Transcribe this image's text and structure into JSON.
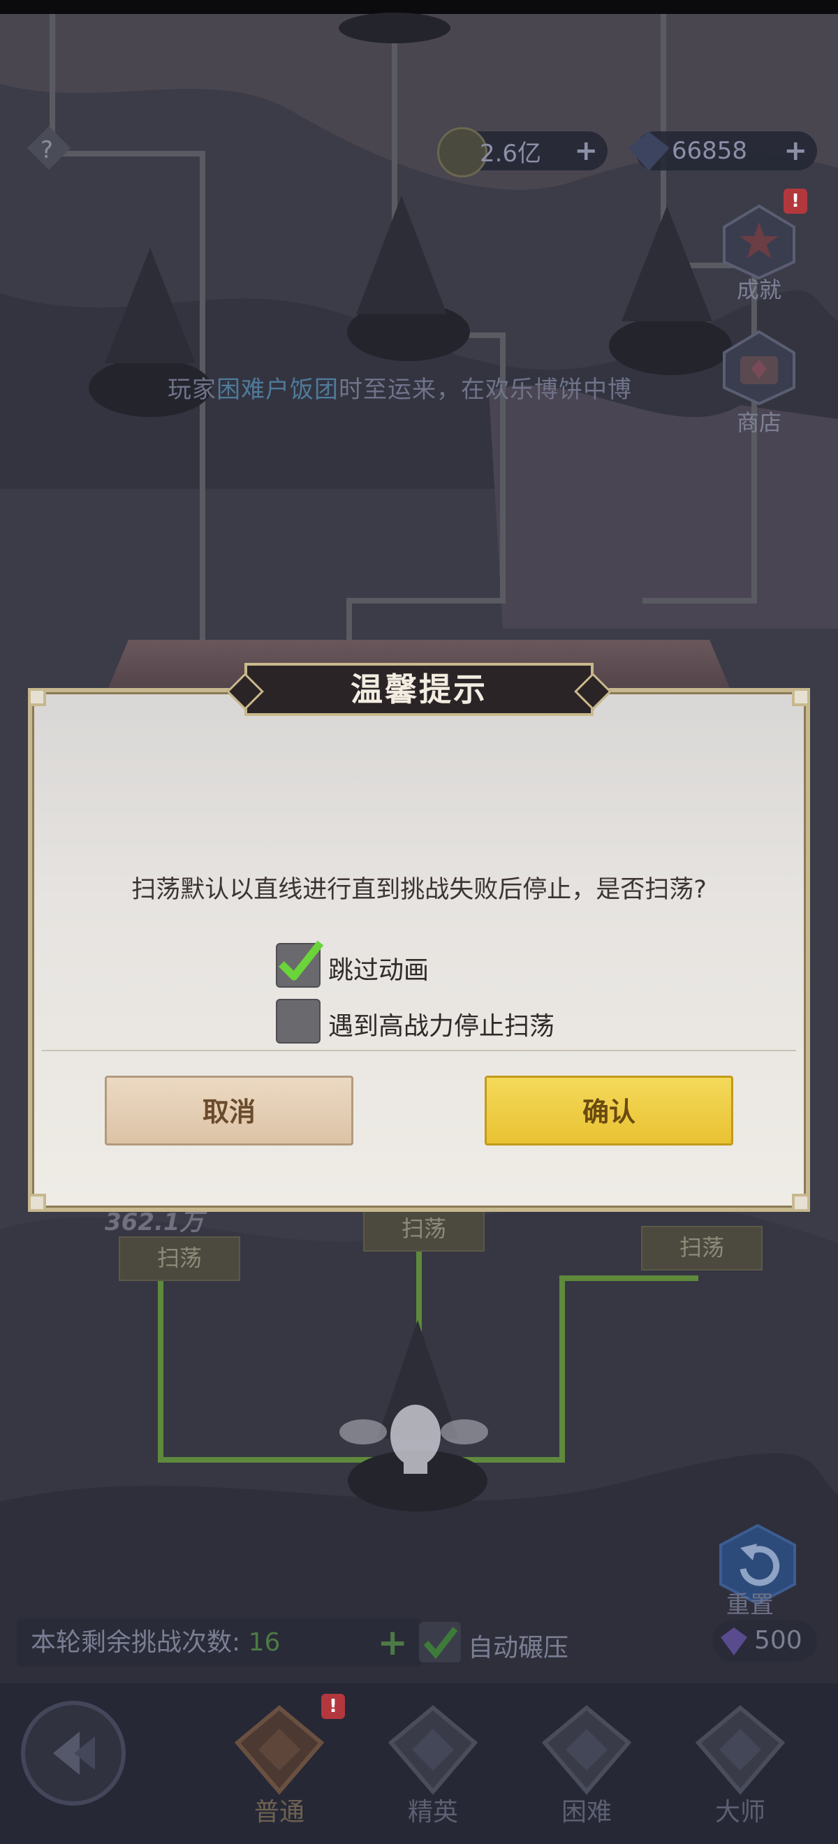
{
  "currency": {
    "gold": "2.6亿",
    "gems": "66858",
    "plus": "+"
  },
  "side": {
    "achievement": "成就",
    "shop": "商店",
    "alert": "!"
  },
  "ticker": {
    "prefix": "玩家",
    "player": "困难户饭团",
    "suffix": "时至运来，在欢乐博饼中博"
  },
  "stages": {
    "sweep": "扫荡",
    "power_left": "362.1万"
  },
  "dialog": {
    "title": "温馨提示",
    "message": "扫荡默认以直线进行直到挑战失败后停止，是否扫荡?",
    "options": [
      {
        "label": "跳过动画",
        "checked": true
      },
      {
        "label": "遇到高战力停止扫荡",
        "checked": false
      }
    ],
    "cancel": "取消",
    "confirm": "确认"
  },
  "footer": {
    "challenge_label": "本轮剩余挑战次数:",
    "challenge_count": "16",
    "auto_label": "自动碾压",
    "reset_label": "重置",
    "reset_cost": "500",
    "tabs": [
      "普通",
      "精英",
      "困难",
      "大师"
    ]
  },
  "colors": {
    "confirm": "#f0cc3e",
    "cancel": "#e4cdb2",
    "check": "#6ad43a"
  }
}
